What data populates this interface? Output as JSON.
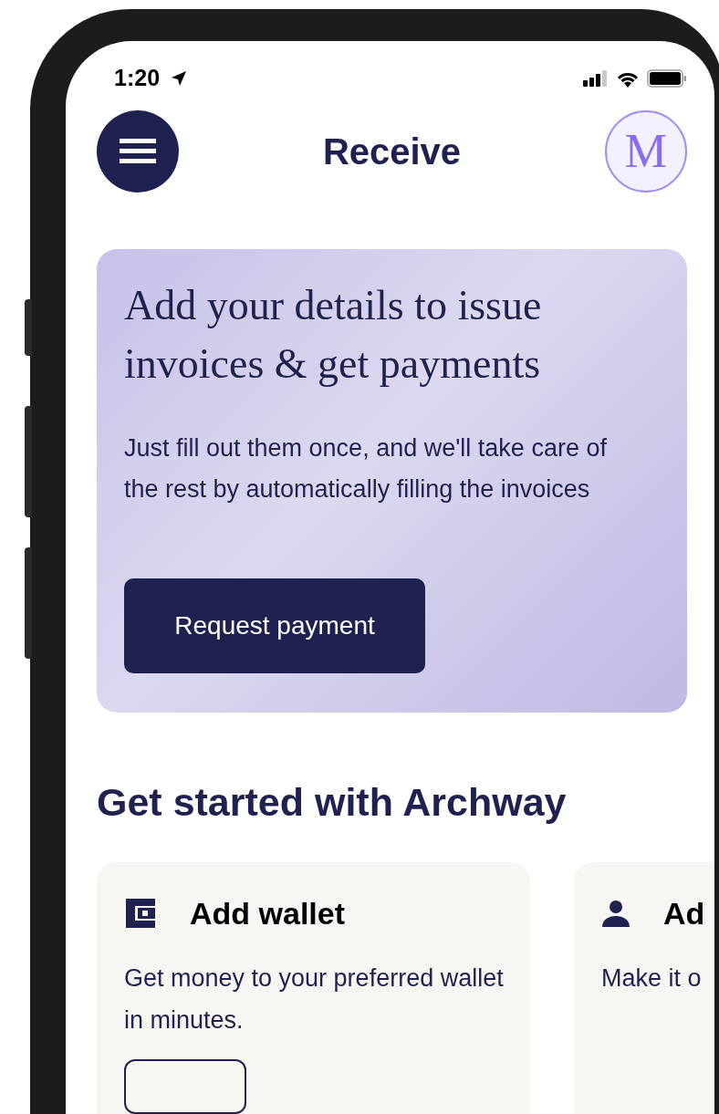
{
  "status_bar": {
    "time": "1:20"
  },
  "header": {
    "title": "Receive",
    "avatar_initial": "M"
  },
  "promo": {
    "heading": "Add your details to issue invoices & get payments",
    "body": "Just fill out them once, and we'll take care of the rest by automatically filling the invoices",
    "button": "Request payment"
  },
  "section_title": "Get started with Archway",
  "cards": [
    {
      "kind": "wallet",
      "title": "Add wallet",
      "description": "Get money to your preferred wallet in minutes."
    },
    {
      "kind": "person",
      "title": "Ad",
      "description": "Make it o"
    }
  ]
}
